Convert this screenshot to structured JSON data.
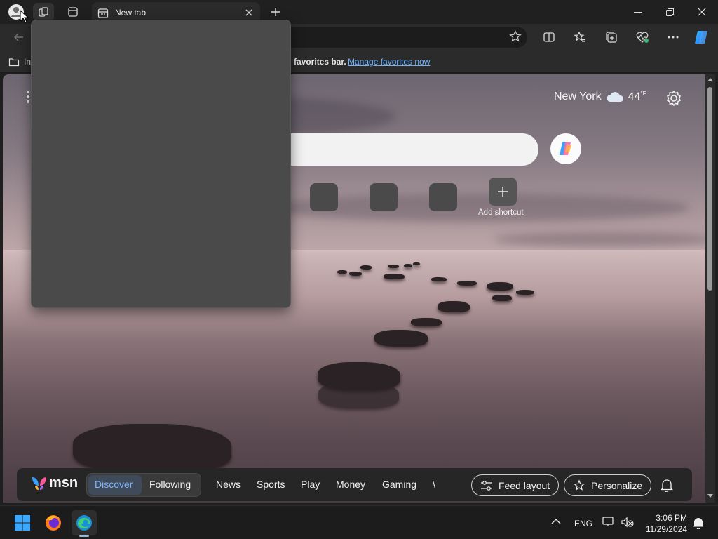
{
  "browser": {
    "tab": {
      "title": "New tab"
    },
    "favorites_bar": {
      "import_label": "In",
      "message": "favorites bar.",
      "manage_link": "Manage favorites now"
    }
  },
  "newtab": {
    "weather": {
      "city": "New York",
      "temp": "44",
      "unit": "°F"
    },
    "shortcuts": {
      "add_label": "Add shortcut"
    },
    "feed": {
      "logo": "msn",
      "tabs": [
        "Discover",
        "Following"
      ],
      "categories": [
        "News",
        "Sports",
        "Play",
        "Money",
        "Gaming",
        "\\"
      ],
      "feed_layout_label": "Feed layout",
      "personalize_label": "Personalize"
    }
  },
  "taskbar": {
    "language": "ENG",
    "time": "3:06 PM",
    "date": "11/29/2024"
  },
  "colors": {
    "accent_link": "#6fb2ff",
    "active_feed_tab": "#7ab8ff"
  }
}
